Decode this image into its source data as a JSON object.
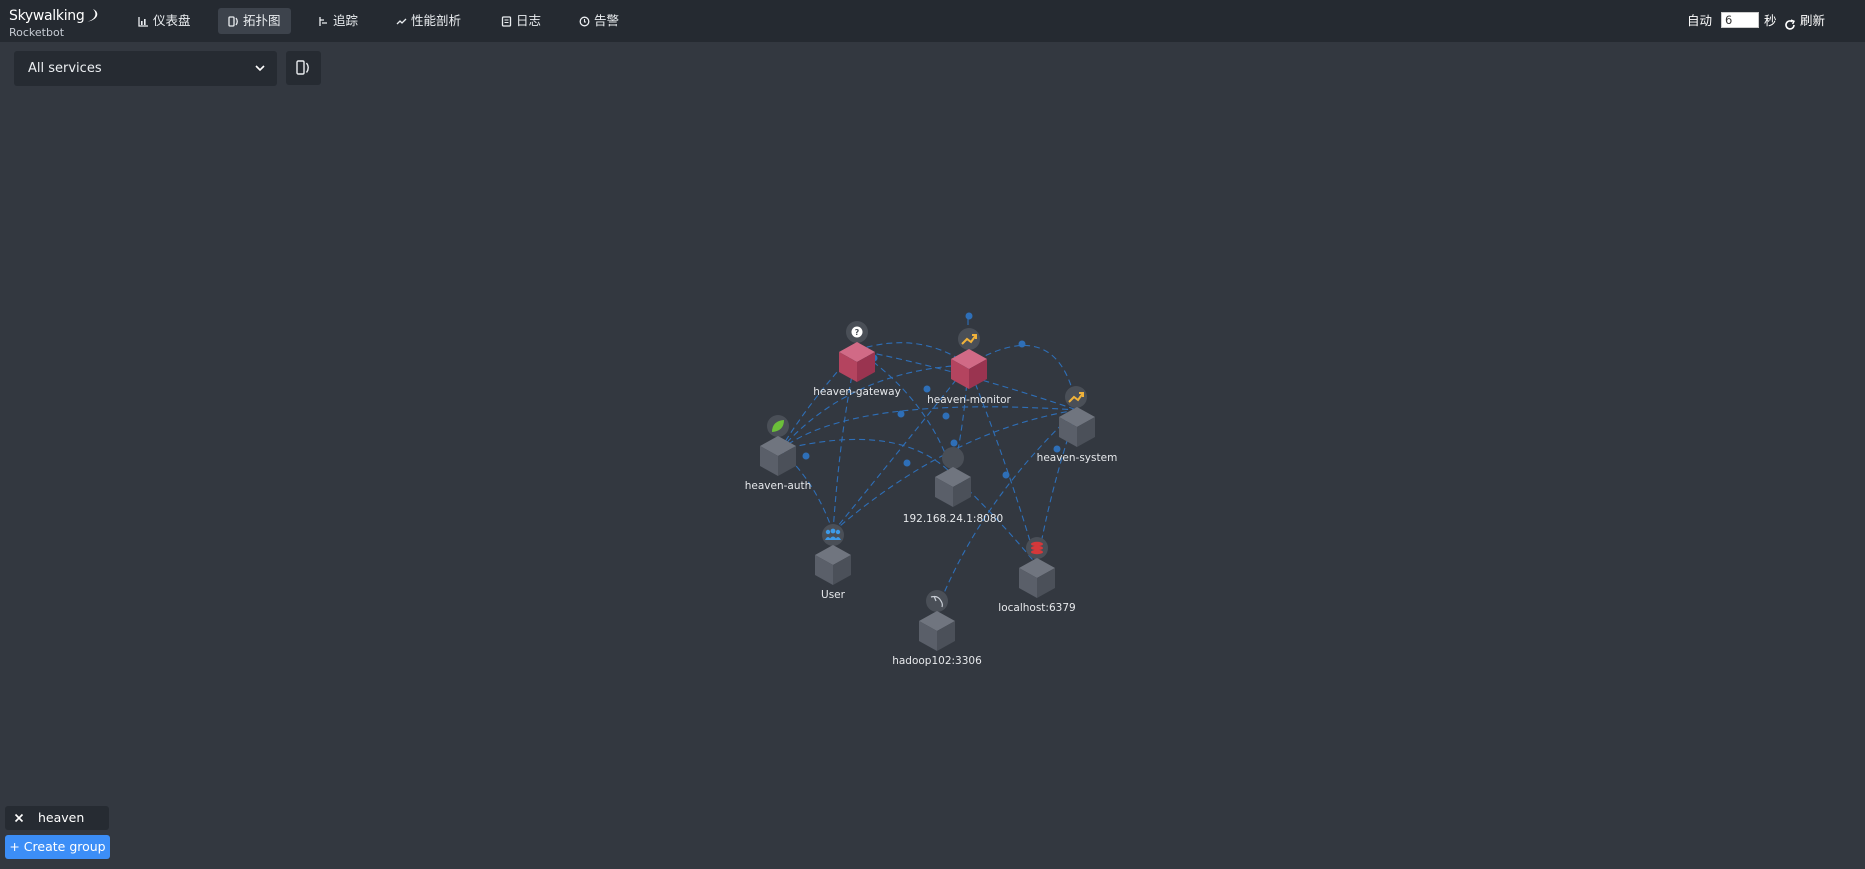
{
  "app": {
    "brand": "Skywalking",
    "subtitle": "Rocketbot"
  },
  "nav": [
    {
      "label": "仪表盘",
      "icon": "bar-chart-icon",
      "active": false
    },
    {
      "label": "拓扑图",
      "icon": "topology-icon",
      "active": true
    },
    {
      "label": "追踪",
      "icon": "trace-icon",
      "active": false
    },
    {
      "label": "性能剖析",
      "icon": "line-chart-icon",
      "active": false
    },
    {
      "label": "日志",
      "icon": "log-icon",
      "active": false
    },
    {
      "label": "告警",
      "icon": "alarm-icon",
      "active": false
    }
  ],
  "controls": {
    "auto_label": "自动",
    "interval_value": "6",
    "interval_unit": "秒",
    "refresh_label": "刷新"
  },
  "service_select": {
    "value": "All services"
  },
  "topology": {
    "link_color": "#2e6fb8",
    "nodes": [
      {
        "id": "gateway",
        "label": "heaven-gateway",
        "kind": "service",
        "icon": "question-icon",
        "color": "#b5425e"
      },
      {
        "id": "monitor",
        "label": "heaven-monitor",
        "kind": "service",
        "icon": "shuffle-icon",
        "color": "#b5425e"
      },
      {
        "id": "auth",
        "label": "heaven-auth",
        "kind": "service",
        "icon": "leaf-icon",
        "color": "#5a5f69"
      },
      {
        "id": "system",
        "label": "heaven-system",
        "kind": "service",
        "icon": "shuffle-icon",
        "color": "#5a5f69"
      },
      {
        "id": "ip",
        "label": "192.168.24.1:8080",
        "kind": "endpoint",
        "icon": "blank-icon",
        "color": "#5a5f69"
      },
      {
        "id": "user",
        "label": "User",
        "kind": "user",
        "icon": "users-icon",
        "color": "#5a5f69"
      },
      {
        "id": "redis",
        "label": "localhost:6379",
        "kind": "database",
        "icon": "redis-icon",
        "color": "#5a5f69"
      },
      {
        "id": "mysql",
        "label": "hadoop102:3306",
        "kind": "database",
        "icon": "dolphin-icon",
        "color": "#5a5f69"
      }
    ]
  },
  "groups": {
    "tag": "heaven",
    "create_label": "+ Create group"
  }
}
